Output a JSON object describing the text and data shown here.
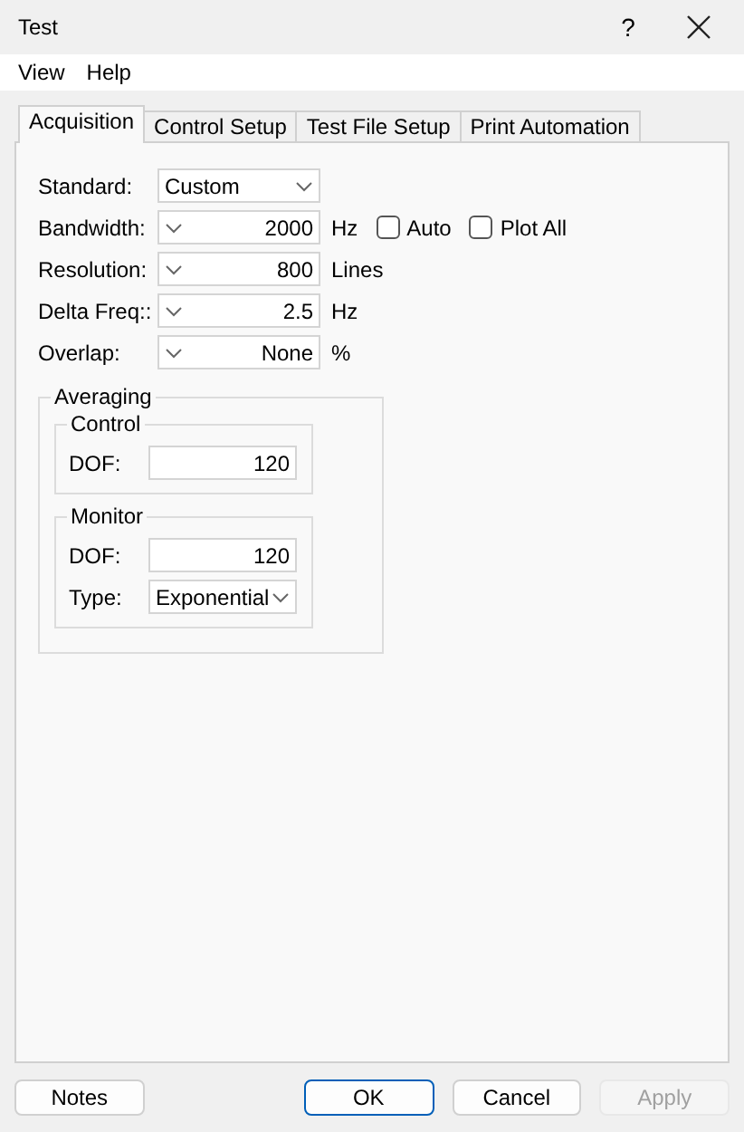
{
  "window": {
    "title": "Test",
    "help": "?"
  },
  "menu": [
    "View",
    "Help"
  ],
  "tabs": [
    {
      "label": "Acquisition",
      "selected": true
    },
    {
      "label": "Control Setup",
      "selected": false
    },
    {
      "label": "Test File Setup",
      "selected": false
    },
    {
      "label": "Print Automation",
      "selected": false
    }
  ],
  "settings": [
    {
      "kind": "dropdown",
      "label": "Standard:",
      "value": "Custom"
    },
    {
      "kind": "spin",
      "label": "Bandwidth:",
      "value": "2000",
      "unit": "Hz",
      "checkboxes": [
        {
          "label": "Auto",
          "checked": false
        },
        {
          "label": "Plot All",
          "checked": false
        }
      ]
    },
    {
      "kind": "spin",
      "label": "Resolution:",
      "value": "800",
      "unit": "Lines"
    },
    {
      "kind": "spin",
      "label": "Delta Freq::",
      "value": "2.5",
      "unit": "Hz"
    },
    {
      "kind": "spin",
      "label": "Overlap:",
      "value": "None",
      "unit": "%"
    }
  ],
  "averaging": {
    "title": "Averaging",
    "groups": [
      {
        "title": "Control",
        "fields": [
          {
            "kind": "text",
            "label": "DOF:",
            "value": "120"
          }
        ]
      },
      {
        "title": "Monitor",
        "fields": [
          {
            "kind": "text",
            "label": "DOF:",
            "value": "120"
          },
          {
            "kind": "dropdown",
            "label": "Type:",
            "value": "Exponential"
          }
        ]
      }
    ]
  },
  "buttons": [
    {
      "label": "Notes",
      "default": false,
      "disabled": false
    },
    {
      "label": "OK",
      "default": true,
      "disabled": false
    },
    {
      "label": "Cancel",
      "default": false,
      "disabled": false
    },
    {
      "label": "Apply",
      "default": false,
      "disabled": true
    }
  ]
}
